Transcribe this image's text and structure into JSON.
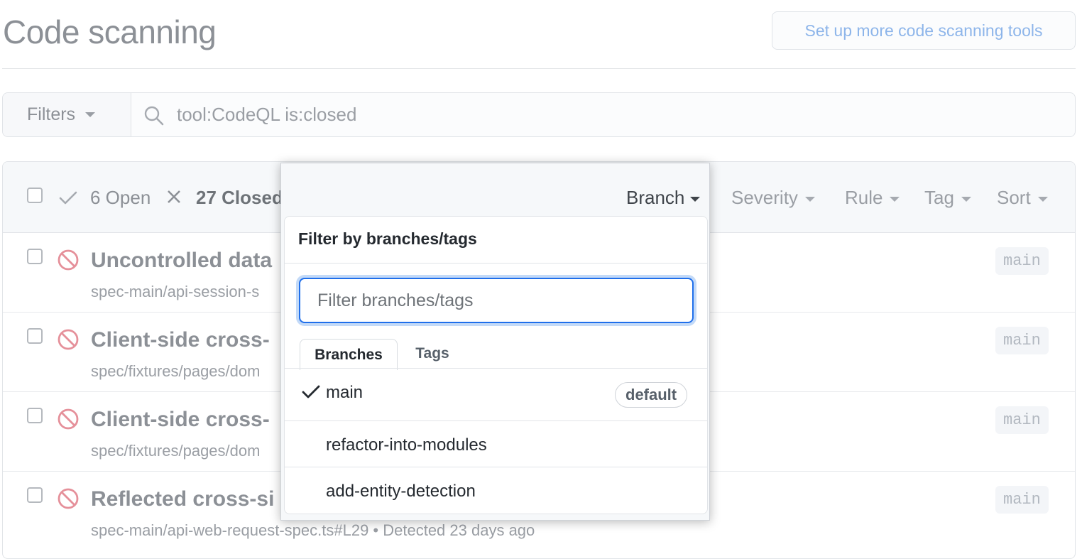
{
  "page": {
    "title": "Code scanning",
    "setup_button": "Set up more code scanning tools"
  },
  "search": {
    "filters_label": "Filters",
    "query": "tool:CodeQL is:closed"
  },
  "list_header": {
    "open_label": "6 Open",
    "closed_label": "27 Closed",
    "menus": [
      "Branch",
      "Severity",
      "Rule",
      "Tag",
      "Sort"
    ]
  },
  "alerts": [
    {
      "title": "Uncontrolled data",
      "path": "spec-main/api-session-s",
      "branch": "main"
    },
    {
      "title": "Client-side cross-",
      "path": "spec/fixtures/pages/dom",
      "branch": "main"
    },
    {
      "title": "Client-side cross-",
      "path": "spec/fixtures/pages/dom",
      "branch": "main"
    },
    {
      "title": "Reflected cross-si",
      "path": "spec-main/api-web-request-spec.ts#L29 • Detected 23 days ago",
      "branch": "main"
    }
  ],
  "branch_dropdown": {
    "title": "Filter by branches/tags",
    "placeholder": "Filter branches/tags",
    "tabs": [
      "Branches",
      "Tags"
    ],
    "items": [
      {
        "name": "main",
        "selected": true,
        "badge": "default"
      },
      {
        "name": "refactor-into-modules",
        "selected": false
      },
      {
        "name": "add-entity-detection",
        "selected": false
      }
    ]
  },
  "colors": {
    "accent": "#1f6feb",
    "alert_icon": "#e5909a"
  }
}
